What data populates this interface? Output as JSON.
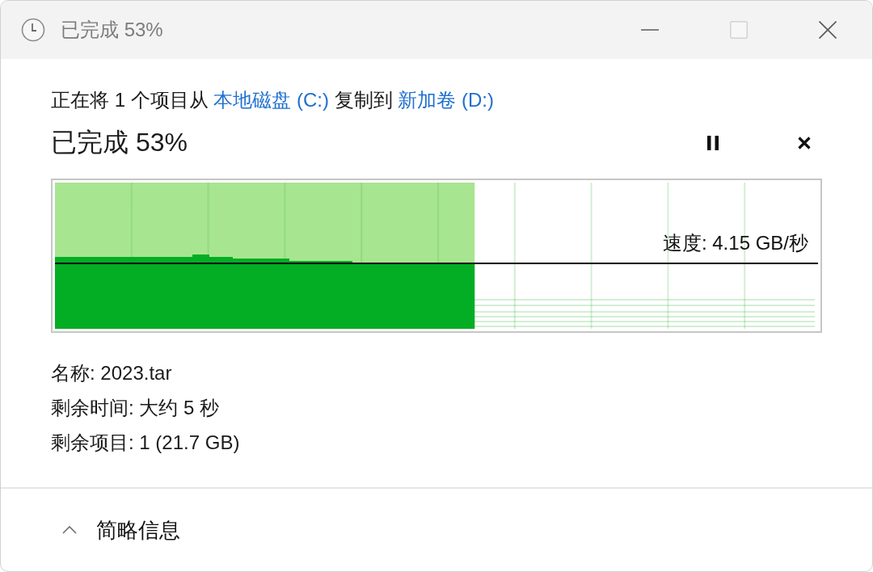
{
  "window": {
    "title": "已完成 53%",
    "controls": [
      {
        "kind": "minimize",
        "disabled": false
      },
      {
        "kind": "maximize",
        "disabled": true
      },
      {
        "kind": "close",
        "disabled": false
      }
    ]
  },
  "copy_line": [
    {
      "kind": "text",
      "text": "正在将 1 个项目从 "
    },
    {
      "kind": "link",
      "text": "本地磁盘 (C:)"
    },
    {
      "kind": "text",
      "text": " 复制到 "
    },
    {
      "kind": "link",
      "text": "新加卷 (D:)"
    }
  ],
  "progress": {
    "heading": "已完成 53%",
    "level": 0.55,
    "speed": "速度: 4.15 GB/秒"
  },
  "details": [
    "名称: 2023.tar",
    "剩余时间: 大约 5 秒",
    "剩余项目: 1 (21.7 GB)"
  ],
  "details_toggle": {
    "label": "简略信息",
    "expanded": true
  }
}
